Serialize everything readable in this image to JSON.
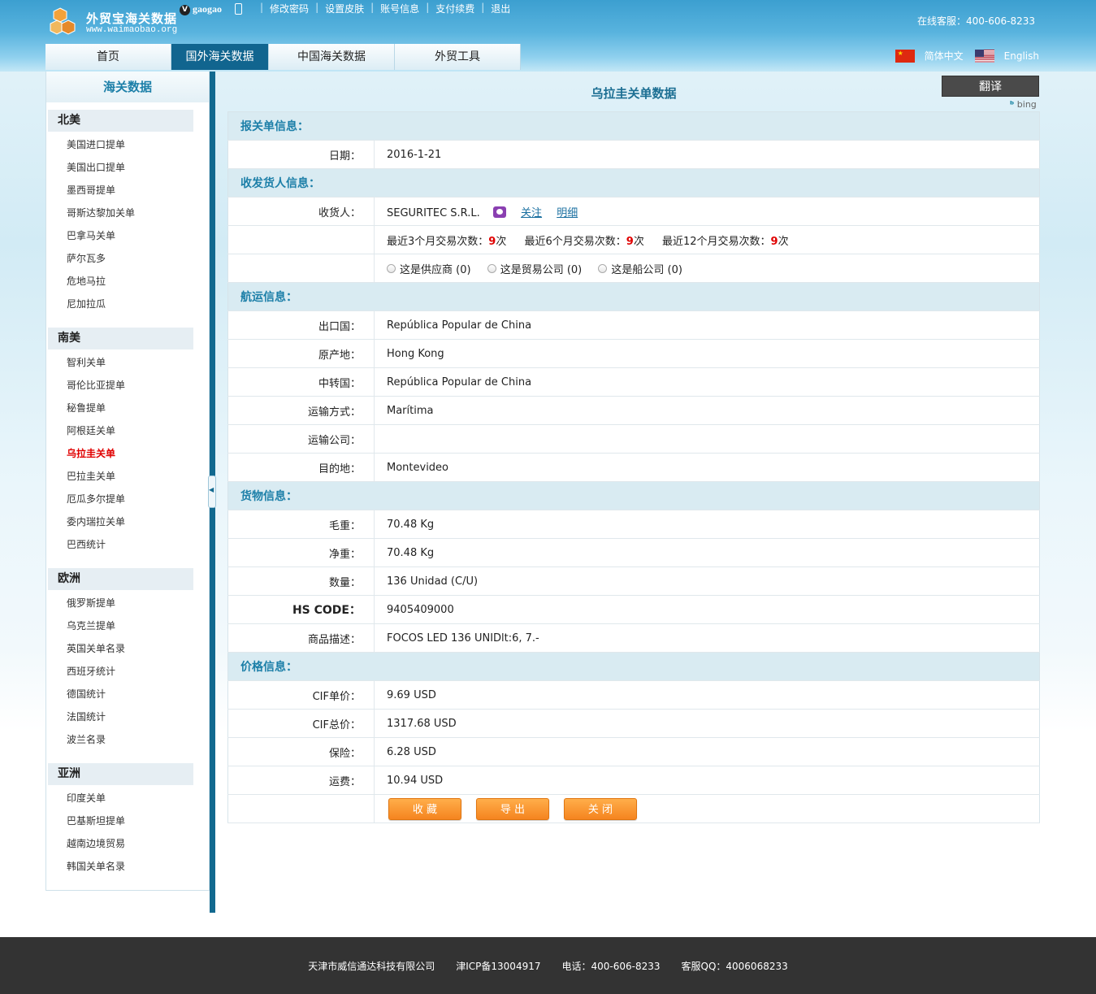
{
  "header": {
    "logo_title": "外贸宝海关数据",
    "logo_url": "www.waimaobao.org",
    "user_badge": "V",
    "username": "gaogao",
    "toplinks": [
      "修改密码",
      "设置皮肤",
      "账号信息",
      "支付续费",
      "退出"
    ],
    "hotline": "在线客服：400-606-8233",
    "nav": [
      {
        "label": "首页",
        "width": 155
      },
      {
        "label": "国外海关数据",
        "width": 120,
        "active": true
      },
      {
        "label": "中国海关数据",
        "width": 155
      },
      {
        "label": "外贸工具",
        "width": 155
      }
    ],
    "lang_cn": "简体中文",
    "lang_en": "English"
  },
  "sidebar": {
    "title": "海关数据",
    "regions": [
      {
        "name": "北美",
        "items": [
          "美国进口提单",
          "美国出口提单",
          "墨西哥提单",
          "哥斯达黎加关单",
          "巴拿马关单",
          "萨尔瓦多",
          "危地马拉",
          "尼加拉瓜"
        ]
      },
      {
        "name": "南美",
        "items": [
          "智利关单",
          "哥伦比亚提单",
          "秘鲁提单",
          "阿根廷关单",
          "乌拉圭关单",
          "巴拉圭关单",
          "厄瓜多尔提单",
          "委内瑞拉关单",
          "巴西统计"
        ],
        "active": "乌拉圭关单"
      },
      {
        "name": "欧洲",
        "items": [
          "俄罗斯提单",
          "乌克兰提单",
          "英国关单名录",
          "西班牙统计",
          "德国统计",
          "法国统计",
          "波兰名录"
        ]
      },
      {
        "name": "亚洲",
        "items": [
          "印度关单",
          "巴基斯坦提单",
          "越南边境贸易",
          "韩国关单名录"
        ]
      }
    ]
  },
  "main": {
    "title": "乌拉圭关单数据",
    "translate_label": "翻译",
    "bing_label": "bing",
    "sections": {
      "declaration": "报关单信息：",
      "parties": "收发货人信息：",
      "shipping": "航运信息：",
      "goods": "货物信息：",
      "price": "价格信息："
    },
    "date_label": "日期：",
    "date_value": "2016-1-21",
    "consignee_label": "收货人：",
    "consignee_value": "SEGURITEC S.R.L.",
    "follow_link": "关注",
    "detail_link": "明细",
    "trade_3m_label": "最近3个月交易次数：",
    "trade_3m_value": "9",
    "trade_6m_label": "最近6个月交易次数：",
    "trade_6m_value": "9",
    "trade_12m_label": "最近12个月交易次数：",
    "trade_12m_value": "9",
    "times_unit": "次",
    "radio_supplier": "这是供应商 (0)",
    "radio_trader": "这是贸易公司 (0)",
    "radio_shipping": "这是船公司 (0)",
    "shipping_rows": [
      {
        "label": "出口国：",
        "value": "República Popular de China"
      },
      {
        "label": "原产地：",
        "value": "Hong Kong"
      },
      {
        "label": "中转国：",
        "value": "República Popular de China"
      },
      {
        "label": "运输方式：",
        "value": "Marítima"
      },
      {
        "label": "运输公司：",
        "value": ""
      },
      {
        "label": "目的地：",
        "value": "Montevideo"
      }
    ],
    "goods_rows": [
      {
        "label": "毛重：",
        "value": "70.48 Kg"
      },
      {
        "label": "净重：",
        "value": "70.48 Kg"
      },
      {
        "label": "数量：",
        "value": "136 Unidad (C/U)"
      },
      {
        "label": "HS CODE：",
        "value": "9405409000",
        "hs": true
      },
      {
        "label": "商品描述：",
        "value": "FOCOS LED 136 UNIDlt:6, 7.-"
      }
    ],
    "price_rows": [
      {
        "label": "CIF单价：",
        "value": "9.69 USD"
      },
      {
        "label": "CIF总价：",
        "value": "1317.68 USD"
      },
      {
        "label": "保险：",
        "value": "6.28 USD"
      },
      {
        "label": "运费：",
        "value": "10.94 USD"
      }
    ],
    "buttons": [
      "收 藏",
      "导 出",
      "关 闭"
    ]
  },
  "footer": {
    "company": "天津市威信通达科技有限公司",
    "icp": "津ICP备13004917",
    "phone": "电话：400-606-8233",
    "qq": "客服QQ：4006068233"
  }
}
